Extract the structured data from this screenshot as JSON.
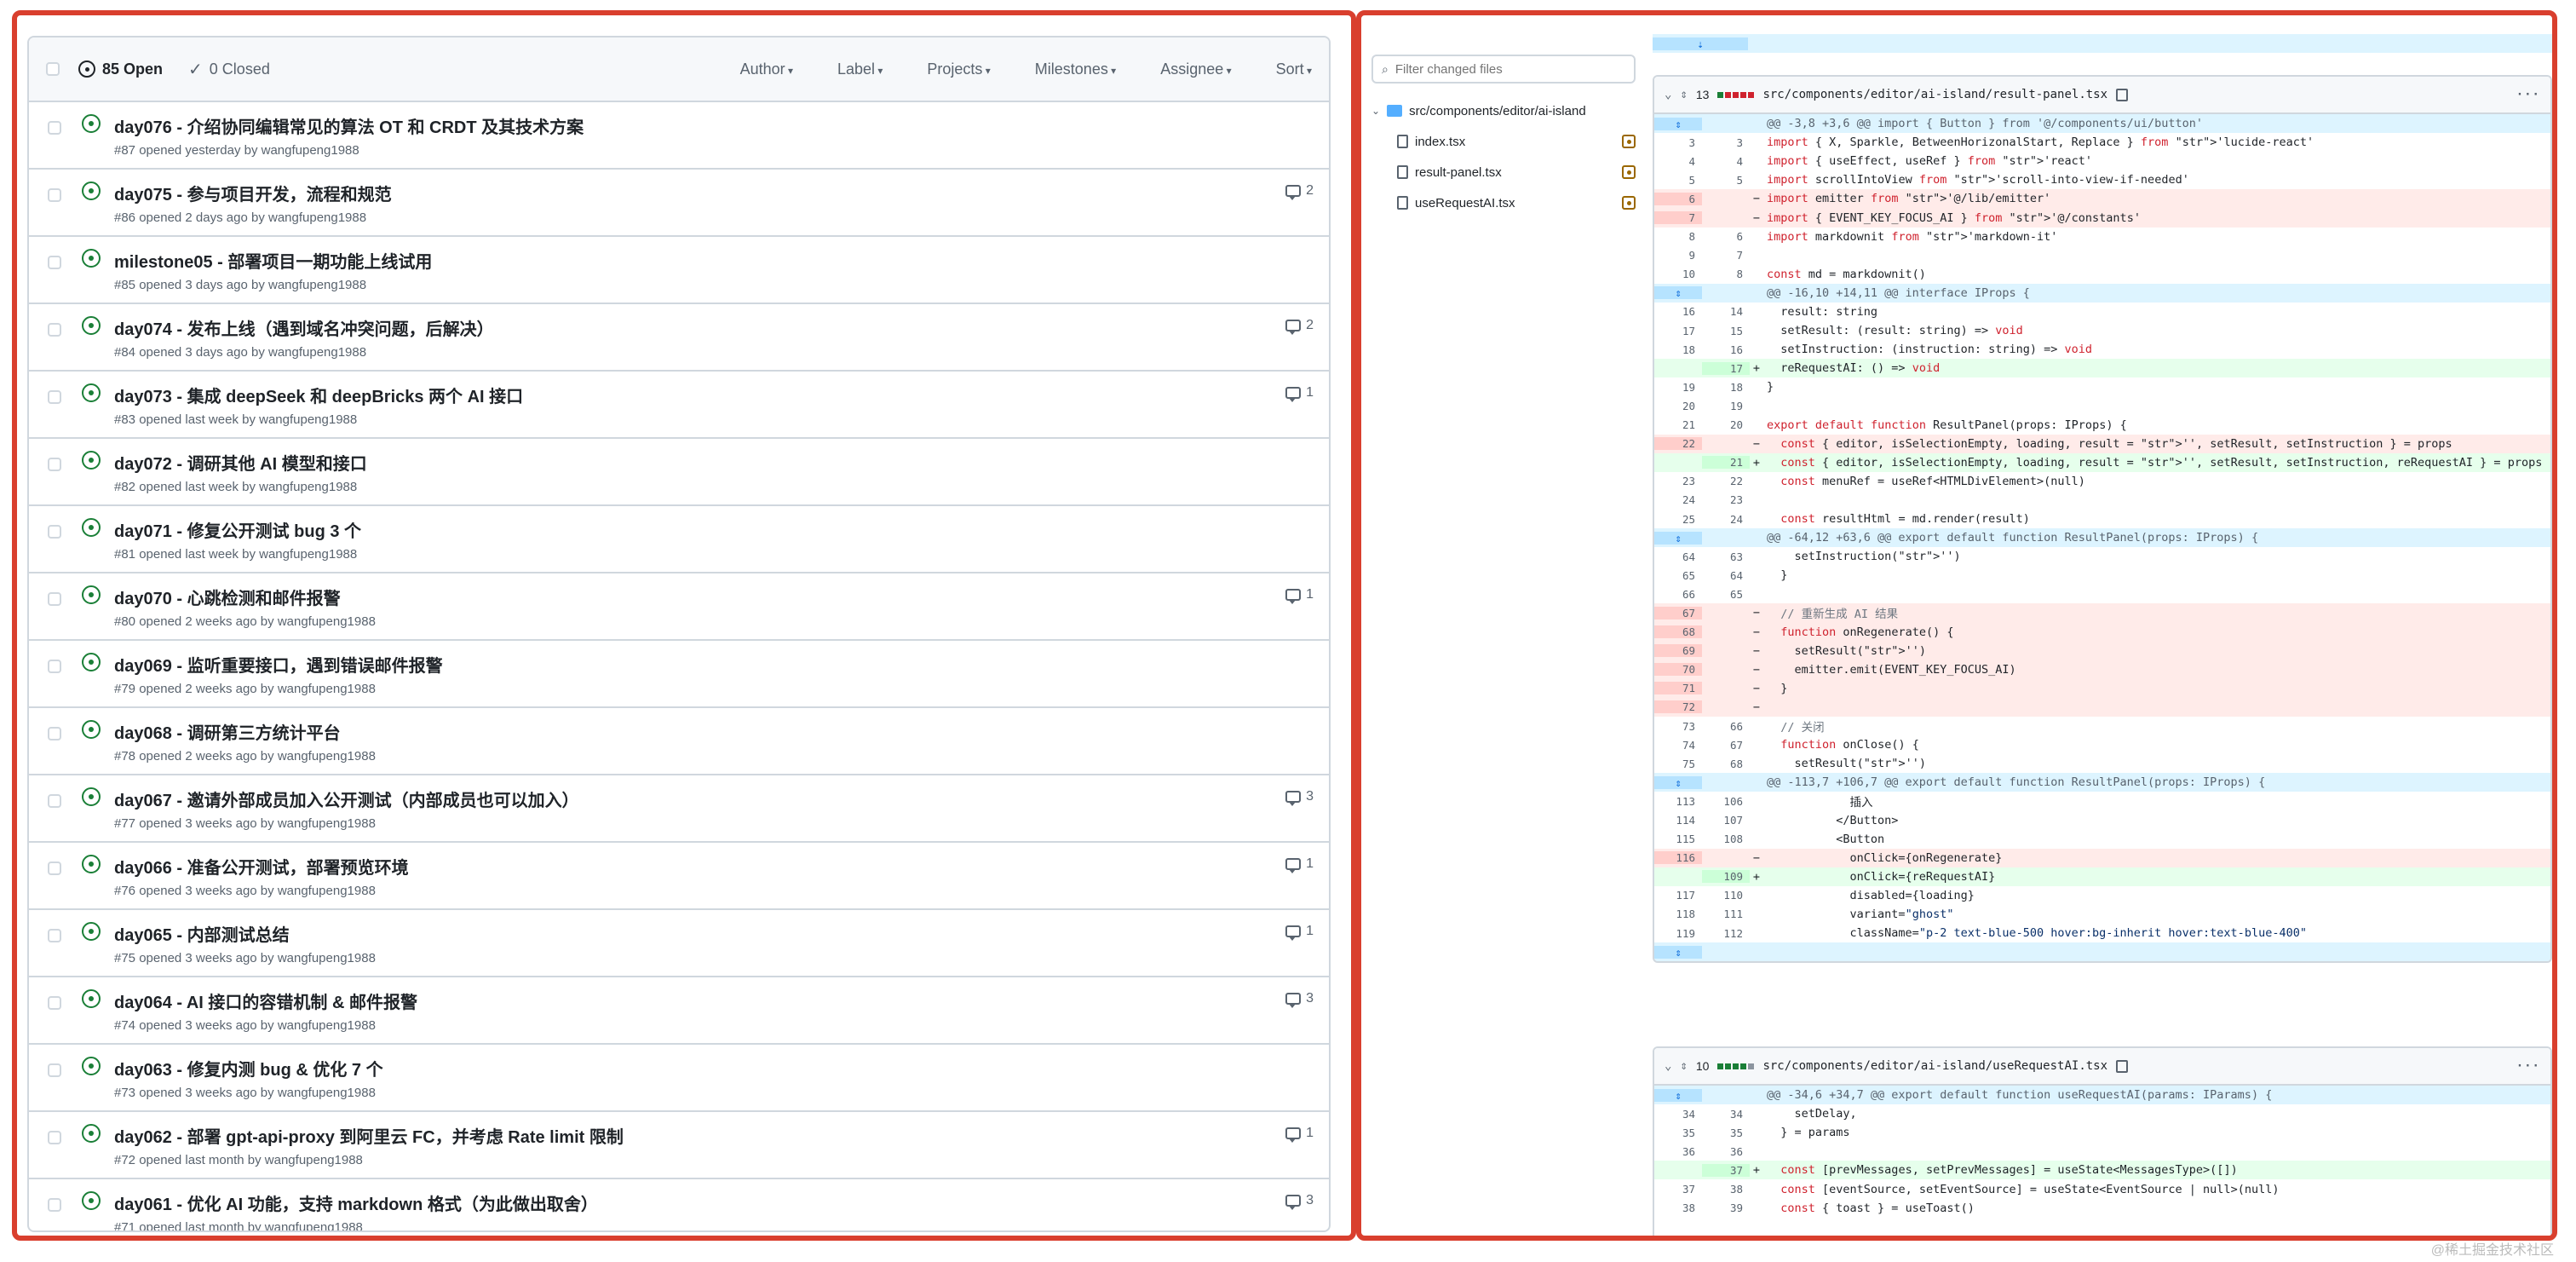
{
  "issues": {
    "open_label": "85 Open",
    "closed_label": "0 Closed",
    "filters": [
      "Author",
      "Label",
      "Projects",
      "Milestones",
      "Assignee",
      "Sort"
    ],
    "rows": [
      {
        "title": "day076 - 介绍协同编辑常见的算法 OT 和 CRDT 及其技术方案",
        "meta": "#87 opened yesterday by wangfupeng1988",
        "comments": ""
      },
      {
        "title": "day075 - 参与项目开发，流程和规范",
        "meta": "#86 opened 2 days ago by wangfupeng1988",
        "comments": "2"
      },
      {
        "title": "milestone05 - 部署项目一期功能上线试用",
        "meta": "#85 opened 3 days ago by wangfupeng1988",
        "comments": ""
      },
      {
        "title": "day074 - 发布上线（遇到域名冲突问题，后解决）",
        "meta": "#84 opened 3 days ago by wangfupeng1988",
        "comments": "2"
      },
      {
        "title": "day073 - 集成 deepSeek 和 deepBricks 两个 AI 接口",
        "meta": "#83 opened last week by wangfupeng1988",
        "comments": "1"
      },
      {
        "title": "day072 - 调研其他 AI 模型和接口",
        "meta": "#82 opened last week by wangfupeng1988",
        "comments": ""
      },
      {
        "title": "day071 - 修复公开测试 bug 3 个",
        "meta": "#81 opened last week by wangfupeng1988",
        "comments": ""
      },
      {
        "title": "day070 - 心跳检测和邮件报警",
        "meta": "#80 opened 2 weeks ago by wangfupeng1988",
        "comments": "1"
      },
      {
        "title": "day069 - 监听重要接口，遇到错误邮件报警",
        "meta": "#79 opened 2 weeks ago by wangfupeng1988",
        "comments": ""
      },
      {
        "title": "day068 - 调研第三方统计平台",
        "meta": "#78 opened 2 weeks ago by wangfupeng1988",
        "comments": ""
      },
      {
        "title": "day067 - 邀请外部成员加入公开测试（内部成员也可以加入）",
        "meta": "#77 opened 3 weeks ago by wangfupeng1988",
        "comments": "3"
      },
      {
        "title": "day066 - 准备公开测试，部署预览环境",
        "meta": "#76 opened 3 weeks ago by wangfupeng1988",
        "comments": "1"
      },
      {
        "title": "day065 - 内部测试总结",
        "meta": "#75 opened 3 weeks ago by wangfupeng1988",
        "comments": "1"
      },
      {
        "title": "day064 - AI 接口的容错机制 & 邮件报警",
        "meta": "#74 opened 3 weeks ago by wangfupeng1988",
        "comments": "3"
      },
      {
        "title": "day063 - 修复内测 bug & 优化 7 个",
        "meta": "#73 opened 3 weeks ago by wangfupeng1988",
        "comments": ""
      },
      {
        "title": "day062 - 部署 gpt-api-proxy 到阿里云 FC，并考虑 Rate limit 限制",
        "meta": "#72 opened last month by wangfupeng1988",
        "comments": "1"
      },
      {
        "title": "day061 - 优化 AI 功能，支持 markdown 格式（为此做出取舍）",
        "meta": "#71 opened last month by wangfupeng1988",
        "comments": "3"
      }
    ]
  },
  "files": {
    "filter_placeholder": "Filter changed files",
    "folder": "src/components/editor/ai-island",
    "items": [
      "index.tsx",
      "result-panel.tsx",
      "useRequestAI.tsx"
    ]
  },
  "diff1": {
    "count": "13",
    "path": "src/components/editor/ai-island/result-panel.tsx",
    "lines": [
      [
        "hunk",
        "",
        "",
        "@@ -3,8 +3,6 @@ import { Button } from '@/components/ui/button'"
      ],
      [
        "ctx",
        "3",
        "3",
        "import { X, Sparkle, BetweenHorizonalStart, Replace } from 'lucide-react'"
      ],
      [
        "ctx",
        "4",
        "4",
        "import { useEffect, useRef } from 'react'"
      ],
      [
        "ctx",
        "5",
        "5",
        "import scrollIntoView from 'scroll-into-view-if-needed'"
      ],
      [
        "del",
        "6",
        "",
        "import emitter from '@/lib/emitter'"
      ],
      [
        "del",
        "7",
        "",
        "import { EVENT_KEY_FOCUS_AI } from '@/constants'"
      ],
      [
        "ctx",
        "8",
        "6",
        "import markdownit from 'markdown-it'"
      ],
      [
        "ctx",
        "9",
        "7",
        ""
      ],
      [
        "ctx",
        "10",
        "8",
        "const md = markdownit()"
      ],
      [
        "hunk",
        "",
        "",
        "@@ -16,10 +14,11 @@ interface IProps {"
      ],
      [
        "ctx",
        "16",
        "14",
        "  result: string"
      ],
      [
        "ctx",
        "17",
        "15",
        "  setResult: (result: string) => void"
      ],
      [
        "ctx",
        "18",
        "16",
        "  setInstruction: (instruction: string) => void"
      ],
      [
        "add",
        "",
        "17",
        "  reRequestAI: () => void"
      ],
      [
        "ctx",
        "19",
        "18",
        "}"
      ],
      [
        "ctx",
        "20",
        "19",
        ""
      ],
      [
        "ctx",
        "21",
        "20",
        "export default function ResultPanel(props: IProps) {"
      ],
      [
        "del",
        "22",
        "",
        "  const { editor, isSelectionEmpty, loading, result = '', setResult, setInstruction } = props"
      ],
      [
        "add",
        "",
        "21",
        "  const { editor, isSelectionEmpty, loading, result = '', setResult, setInstruction, reRequestAI } = props"
      ],
      [
        "ctx",
        "23",
        "22",
        "  const menuRef = useRef<HTMLDivElement>(null)"
      ],
      [
        "ctx",
        "24",
        "23",
        ""
      ],
      [
        "ctx",
        "25",
        "24",
        "  const resultHtml = md.render(result)"
      ],
      [
        "hunk",
        "",
        "",
        "@@ -64,12 +63,6 @@ export default function ResultPanel(props: IProps) {"
      ],
      [
        "ctx",
        "64",
        "63",
        "    setInstruction('')"
      ],
      [
        "ctx",
        "65",
        "64",
        "  }"
      ],
      [
        "ctx",
        "66",
        "65",
        ""
      ],
      [
        "del",
        "67",
        "",
        "  // 重新生成 AI 结果"
      ],
      [
        "del",
        "68",
        "",
        "  function onRegenerate() {"
      ],
      [
        "del",
        "69",
        "",
        "    setResult('')"
      ],
      [
        "del",
        "70",
        "",
        "    emitter.emit(EVENT_KEY_FOCUS_AI)"
      ],
      [
        "del",
        "71",
        "",
        "  }"
      ],
      [
        "del",
        "72",
        "",
        ""
      ],
      [
        "ctx",
        "73",
        "66",
        "  // 关闭"
      ],
      [
        "ctx",
        "74",
        "67",
        "  function onClose() {"
      ],
      [
        "ctx",
        "75",
        "68",
        "    setResult('')"
      ],
      [
        "hunk",
        "",
        "",
        "@@ -113,7 +106,7 @@ export default function ResultPanel(props: IProps) {"
      ],
      [
        "ctx",
        "113",
        "106",
        "            插入"
      ],
      [
        "ctx",
        "114",
        "107",
        "          </Button>"
      ],
      [
        "ctx",
        "115",
        "108",
        "          <Button"
      ],
      [
        "del",
        "116",
        "",
        "            onClick={onRegenerate}"
      ],
      [
        "add",
        "",
        "109",
        "            onClick={reRequestAI}"
      ],
      [
        "ctx",
        "117",
        "110",
        "            disabled={loading}"
      ],
      [
        "ctx",
        "118",
        "111",
        "            variant=\"ghost\""
      ],
      [
        "ctx",
        "119",
        "112",
        "            className=\"p-2 text-blue-500 hover:bg-inherit hover:text-blue-400\""
      ],
      [
        "hunk",
        "",
        "",
        ""
      ]
    ]
  },
  "diff2": {
    "count": "10",
    "path": "src/components/editor/ai-island/useRequestAI.tsx",
    "lines": [
      [
        "hunk",
        "",
        "",
        "@@ -34,6 +34,7 @@ export default function useRequestAI(params: IParams) {"
      ],
      [
        "ctx",
        "34",
        "34",
        "    setDelay,"
      ],
      [
        "ctx",
        "35",
        "35",
        "  } = params"
      ],
      [
        "ctx",
        "36",
        "36",
        ""
      ],
      [
        "add",
        "",
        "37",
        "  const [prevMessages, setPrevMessages] = useState<MessagesType>([])"
      ],
      [
        "ctx",
        "37",
        "38",
        "  const [eventSource, setEventSource] = useState<EventSource | null>(null)"
      ],
      [
        "ctx",
        "38",
        "39",
        "  const { toast } = useToast()"
      ]
    ]
  },
  "watermark": "@稀土掘金技术社区",
  "colors": {
    "accent_border": "#d93f2e",
    "open_green": "#1a7f37",
    "del_bg": "#ffebe9",
    "add_bg": "#e6ffec",
    "hunk_bg": "#ddf4ff"
  }
}
